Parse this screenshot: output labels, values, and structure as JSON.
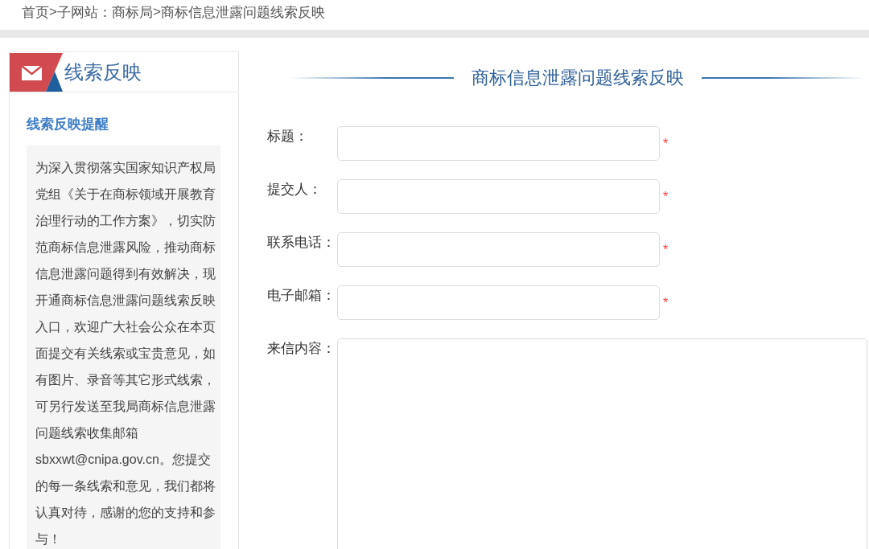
{
  "breadcrumb": [
    {
      "text": "首页",
      "separator": ">"
    },
    {
      "text": "子网站：商标局",
      "separator": ">"
    },
    {
      "text": "商标信息泄露问题线索反映"
    }
  ],
  "sidebar": {
    "title": "线索反映",
    "notice_title": "线索反映提醒",
    "notice_text": "为深入贯彻落实国家知识产权局党组《关于在商标领域开展教育治理行动的工作方案》，切实防范商标信息泄露风险，推动商标信息泄露问题得到有效解决，现开通商标信息泄露问题线索反映入口，欢迎广大社会公众在本页面提交有关线索或宝贵意见，如有图片、录音等其它形式线索，可另行发送至我局商标信息泄露问题线索收集邮箱sbxxwt@cnipa.gov.cn。您提交的每一条线索和意见，我们都将认真对待，感谢的您的支持和参与！"
  },
  "form": {
    "title": "商标信息泄露问题线索反映",
    "fields": [
      {
        "kind": "input",
        "label": "标题：",
        "required_mark": "*"
      },
      {
        "kind": "input",
        "label": "提交人：",
        "required_mark": "*"
      },
      {
        "kind": "input",
        "label": "联系电话：",
        "required_mark": "*"
      },
      {
        "kind": "input",
        "label": "电子邮箱：",
        "required_mark": "*"
      },
      {
        "kind": "textarea",
        "label": "来信内容："
      }
    ]
  }
}
